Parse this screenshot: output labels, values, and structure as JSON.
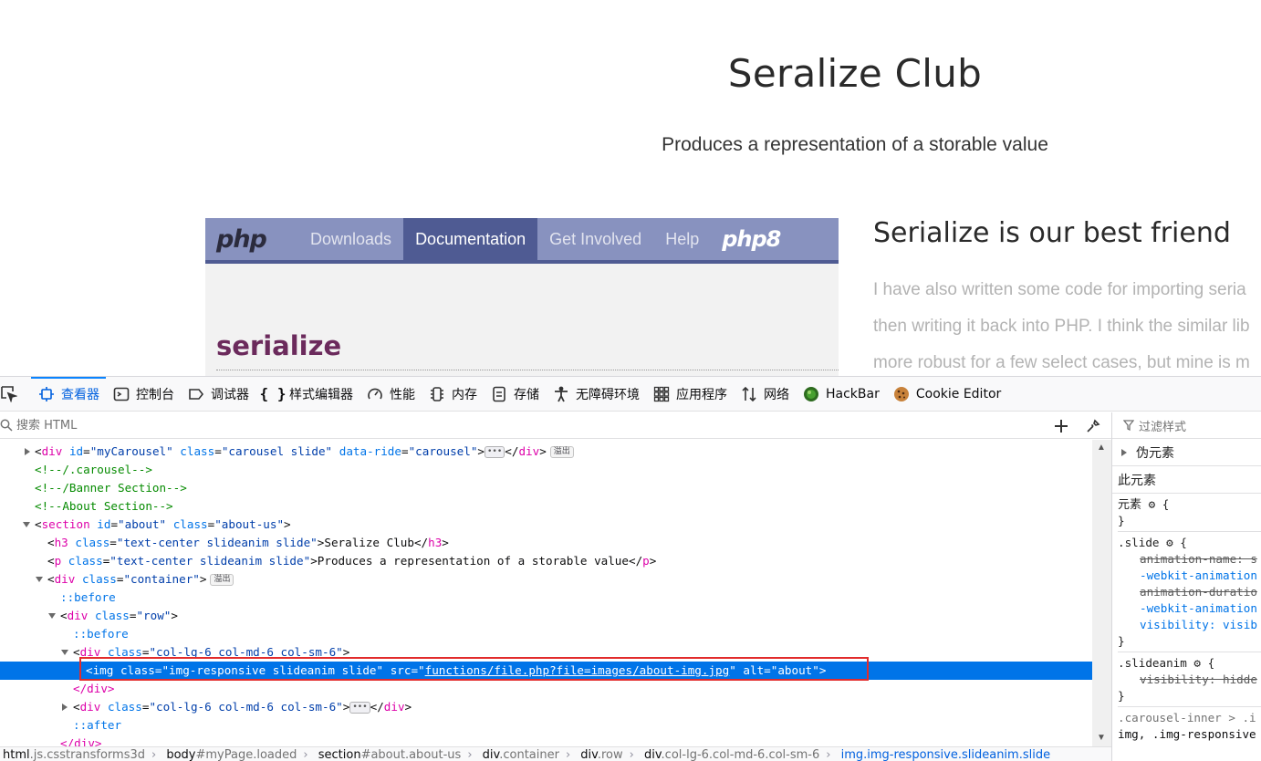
{
  "page": {
    "title": "Seralize Club",
    "subtitle": "Produces a representation of a storable value",
    "php_screenshot": {
      "logo": "php",
      "nav": [
        "Downloads",
        "Documentation",
        "Get Involved",
        "Help"
      ],
      "active_nav": "Documentation",
      "logo8": "php8",
      "heading": "serialize"
    },
    "about_heading": "Serialize is our best friend",
    "about_lines": [
      "I have also written some code for importing seria",
      "then writing it back into PHP. I think the similar lib",
      "more robust for a few select cases, but mine is m"
    ]
  },
  "devtools": {
    "tabs": [
      {
        "label": "查看器",
        "icon": "inspector-icon"
      },
      {
        "label": "控制台",
        "icon": "console-icon"
      },
      {
        "label": "调试器",
        "icon": "debugger-icon"
      },
      {
        "label": "样式编辑器",
        "icon": "style-editor-icon"
      },
      {
        "label": "性能",
        "icon": "performance-icon"
      },
      {
        "label": "内存",
        "icon": "memory-icon"
      },
      {
        "label": "存储",
        "icon": "storage-icon"
      },
      {
        "label": "无障碍环境",
        "icon": "accessibility-icon"
      },
      {
        "label": "应用程序",
        "icon": "application-icon"
      },
      {
        "label": "网络",
        "icon": "network-icon"
      },
      {
        "label": "HackBar",
        "icon": "hackbar-icon"
      },
      {
        "label": "Cookie Editor",
        "icon": "cookie-icon"
      }
    ],
    "active_tab": "查看器",
    "search_placeholder": "搜索 HTML",
    "markup_lines": {
      "l0": {
        "tag": "div",
        "id_attr": "id",
        "id_val": "\"myCarousel\"",
        "class_attr": "class",
        "class_val": "\"carousel slide\"",
        "extra_attr": "data-ride",
        "extra_val": "\"carousel\"",
        "close": "div",
        "badge": "溢出"
      },
      "l1": "<!--/.carousel-->",
      "l2": "<!--/Banner Section-->",
      "l3": "<!--About Section-->",
      "l4": {
        "tag": "section",
        "id_val": "\"about\"",
        "class_val": "\"about-us\""
      },
      "l5": {
        "tag": "h3",
        "class_val": "\"text-center slideanim slide\"",
        "text": "Seralize Club"
      },
      "l6": {
        "tag": "p",
        "class_val": "\"text-center slideanim slide\"",
        "text": "Produces a representation of a storable value"
      },
      "l7": {
        "tag": "div",
        "class_val": "\"container\"",
        "badge": "溢出"
      },
      "l8": "::before",
      "l9": {
        "tag": "div",
        "class_val": "\"row\""
      },
      "l10": "::before",
      "l11": {
        "tag": "div",
        "class_val": "\"col-lg-6 col-md-6 col-sm-6\""
      },
      "l12": {
        "tag": "img",
        "class_val": "\"img-responsive slideanim slide\"",
        "src_attr": "src",
        "src_val": "functions/file.php?file=images/about-img.jpg",
        "alt_attr": "alt",
        "alt_val": "\"about\""
      },
      "l13": "</div>",
      "l14": {
        "tag": "div",
        "class_val": "\"col-lg-6 col-md-6 col-sm-6\"",
        "close": "div"
      },
      "l15": "::after",
      "l16": "</div>"
    },
    "breadcrumbs": [
      {
        "tag": "html",
        "sub": ".js.csstransforms3d"
      },
      {
        "tag": "body",
        "sub": "#myPage.loaded"
      },
      {
        "tag": "section",
        "sub": "#about.about-us"
      },
      {
        "tag": "div",
        "sub": ".container"
      },
      {
        "tag": "div",
        "sub": ".row"
      },
      {
        "tag": "div",
        "sub": ".col-lg-6.col-md-6.col-sm-6"
      },
      {
        "tag": "img",
        "sub": ".img-responsive.slideanim.slide"
      }
    ],
    "rules": {
      "filter_placeholder": "过滤样式",
      "pseudo_section": "伪元素",
      "this_element": "此元素",
      "element_label": "元素",
      "slide_selector": ".slide",
      "slide_props": [
        "animation-name: s",
        "-webkit-animation",
        "animation-duratio",
        "-webkit-animation",
        "visibility: visib"
      ],
      "slideanim_selector": ".slideanim",
      "slideanim_prop": "visibility: hidde",
      "carousel_selector": ".carousel-inner > .i",
      "carousel_selector2": "img, .img-responsive"
    }
  }
}
